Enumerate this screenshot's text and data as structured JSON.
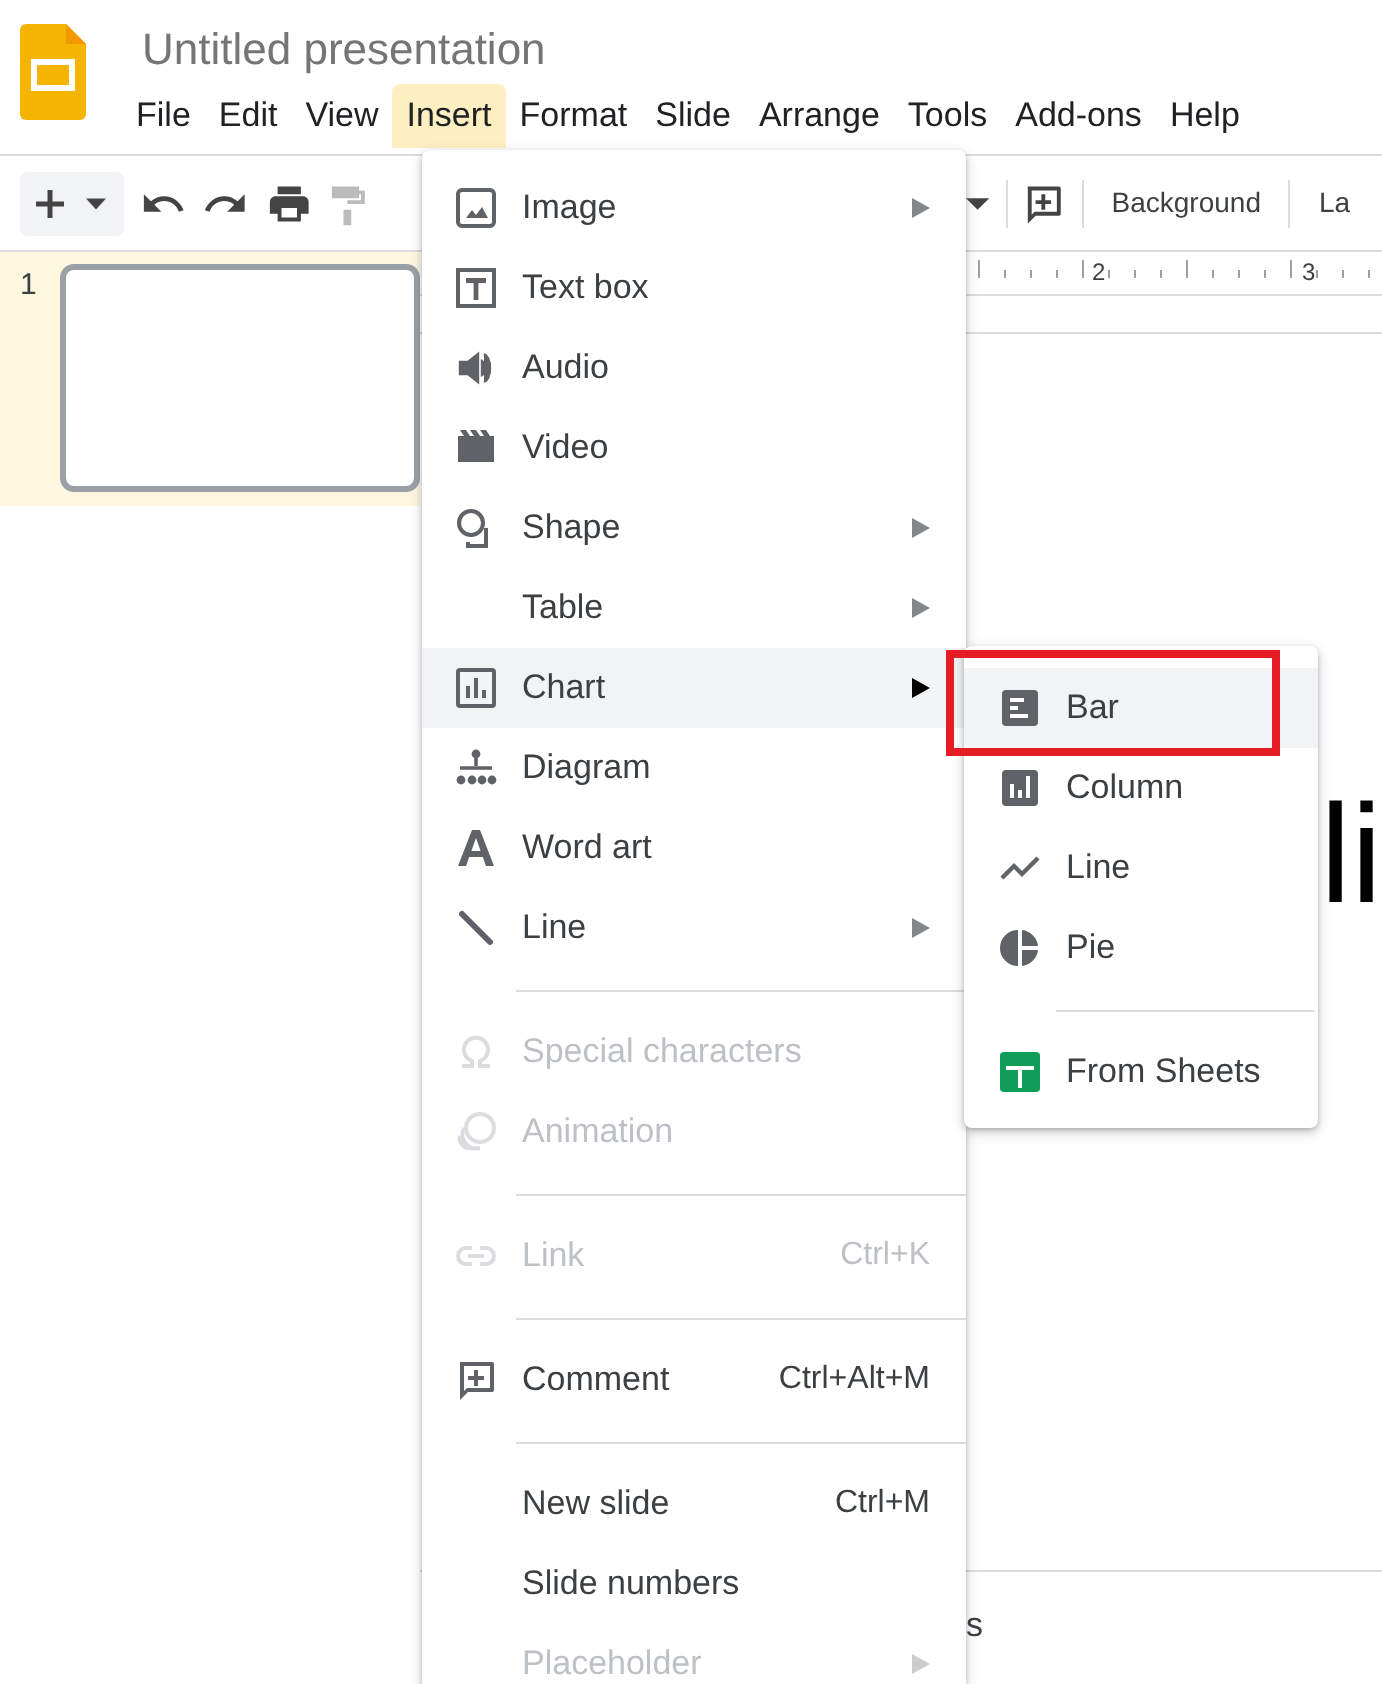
{
  "app": {
    "title": "Untitled presentation",
    "menus": [
      {
        "label": "File",
        "selected": false
      },
      {
        "label": "Edit",
        "selected": false
      },
      {
        "label": "View",
        "selected": false
      },
      {
        "label": "Insert",
        "selected": true
      },
      {
        "label": "Format",
        "selected": false
      },
      {
        "label": "Slide",
        "selected": false
      },
      {
        "label": "Arrange",
        "selected": false
      },
      {
        "label": "Tools",
        "selected": false
      },
      {
        "label": "Add-ons",
        "selected": false
      },
      {
        "label": "Help",
        "selected": false
      }
    ],
    "toolbar": {
      "buttons": [
        "Background",
        "La"
      ]
    },
    "ruler": {
      "labels": [
        "2",
        "3"
      ]
    },
    "filmstrip": [
      {
        "number": "1",
        "selected": true
      }
    ],
    "slide": {
      "title": "li"
    },
    "notes": {
      "text": "s"
    }
  },
  "insert_menu": {
    "items": [
      {
        "kind": "item",
        "label": "Image",
        "submenu": true,
        "disabled": false,
        "selected": false
      },
      {
        "kind": "item",
        "label": "Text box",
        "submenu": false,
        "disabled": false,
        "selected": false
      },
      {
        "kind": "item",
        "label": "Audio",
        "submenu": false,
        "disabled": false,
        "selected": false
      },
      {
        "kind": "item",
        "label": "Video",
        "submenu": false,
        "disabled": false,
        "selected": false
      },
      {
        "kind": "item",
        "label": "Shape",
        "submenu": true,
        "disabled": false,
        "selected": false
      },
      {
        "kind": "item",
        "label": "Table",
        "submenu": true,
        "disabled": false,
        "selected": false
      },
      {
        "kind": "item",
        "label": "Chart",
        "submenu": true,
        "disabled": false,
        "selected": true
      },
      {
        "kind": "item",
        "label": "Diagram",
        "submenu": false,
        "disabled": false,
        "selected": false
      },
      {
        "kind": "item",
        "label": "Word art",
        "submenu": false,
        "disabled": false,
        "selected": false
      },
      {
        "kind": "item",
        "label": "Line",
        "submenu": true,
        "disabled": false,
        "selected": false
      },
      {
        "kind": "separator"
      },
      {
        "kind": "item",
        "label": "Special characters",
        "submenu": false,
        "disabled": true,
        "selected": false
      },
      {
        "kind": "item",
        "label": "Animation",
        "submenu": false,
        "disabled": true,
        "selected": false
      },
      {
        "kind": "separator"
      },
      {
        "kind": "item",
        "label": "Link",
        "shortcut": "Ctrl+K",
        "submenu": false,
        "disabled": true,
        "selected": false
      },
      {
        "kind": "separator"
      },
      {
        "kind": "item",
        "label": "Comment",
        "shortcut": "Ctrl+Alt+M",
        "submenu": false,
        "disabled": false,
        "selected": false
      },
      {
        "kind": "separator"
      },
      {
        "kind": "item",
        "label": "New slide",
        "shortcut": "Ctrl+M",
        "submenu": false,
        "disabled": false,
        "selected": false
      },
      {
        "kind": "item",
        "label": "Slide numbers",
        "submenu": false,
        "disabled": false,
        "selected": false
      },
      {
        "kind": "item",
        "label": "Placeholder",
        "submenu": true,
        "disabled": true,
        "selected": false
      }
    ]
  },
  "chart_menu": {
    "items": [
      {
        "kind": "item",
        "label": "Bar",
        "selected": true,
        "highlighted": true
      },
      {
        "kind": "item",
        "label": "Column",
        "selected": false,
        "highlighted": false
      },
      {
        "kind": "item",
        "label": "Line",
        "selected": false,
        "highlighted": false
      },
      {
        "kind": "item",
        "label": "Pie",
        "selected": false,
        "highlighted": false
      },
      {
        "kind": "separator"
      },
      {
        "kind": "item",
        "label": "From Sheets",
        "selected": false,
        "highlighted": false
      }
    ]
  }
}
